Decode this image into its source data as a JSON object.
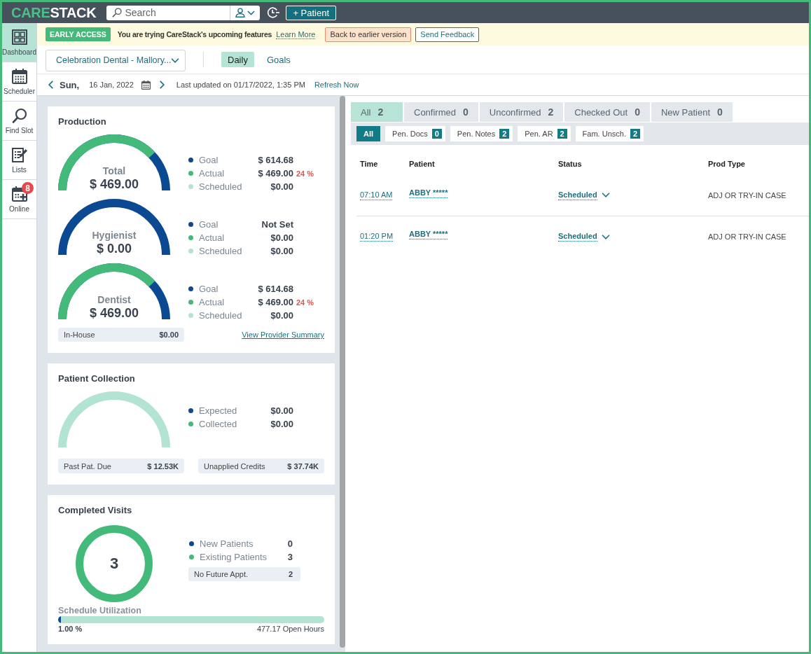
{
  "top_bar": {
    "logo": {
      "accent": "CARE",
      "main": "STACK"
    },
    "search": {
      "placeholder": "Search"
    },
    "add_button": "+ Patient"
  },
  "sidebar": {
    "items": [
      {
        "label": "Dashboard",
        "selected": true
      },
      {
        "label": "Scheduler",
        "selected": false
      },
      {
        "label": "Find Slot",
        "selected": false
      },
      {
        "label": "Lists",
        "selected": false
      },
      {
        "label": "Online",
        "selected": false,
        "badge": "8"
      }
    ]
  },
  "banner": {
    "tag": "EARLY ACCESS",
    "message": "You are trying CareStack's upcoming features",
    "link": "Learn More",
    "buttons": [
      {
        "label": "Back to earlier version",
        "kind": "warning"
      },
      {
        "label": "Send Feedback",
        "kind": "outline"
      }
    ]
  },
  "toolbar": {
    "location": "Celebration Dental - Mallory...",
    "tabs": [
      {
        "label": "Daily",
        "selected": true
      },
      {
        "label": "Goals",
        "selected": false
      }
    ]
  },
  "date_bar": {
    "day": "Sun,",
    "date": "16 Jan, 2022",
    "last_updated": "Last updated on 01/17/2022, 1:35 PM",
    "refresh_link": "Refresh Now"
  },
  "production": {
    "title": "Production",
    "gauges": [
      {
        "label": "Total",
        "amount": "$ 469.00",
        "level": 0.76,
        "legend": [
          {
            "label": "Goal",
            "value": "$ 614.68",
            "color": "#0b4a93"
          },
          {
            "label": "Actual",
            "value": "$ 469.00",
            "percent": "24 %",
            "color": "#43b97a"
          },
          {
            "label": "Scheduled",
            "value": "$0.00",
            "color": "#b3e3d3"
          }
        ]
      },
      {
        "label": "Hygienist",
        "amount": "$ 0.00",
        "legend": [
          {
            "label": "Goal",
            "value": "Not Set",
            "color": "#0b4a93"
          },
          {
            "label": "Actual",
            "value": "$0.00",
            "color": "#43b97a"
          },
          {
            "label": "Scheduled",
            "value": "$0.00",
            "color": "#b3e3d3"
          }
        ]
      },
      {
        "label": "Dentist",
        "amount": "$ 469.00",
        "level": 0.76,
        "legend": [
          {
            "label": "Goal",
            "value": "$ 614.68",
            "color": "#0b4a93"
          },
          {
            "label": "Actual",
            "value": "$ 469.00",
            "percent": "24 %",
            "color": "#43b97a"
          },
          {
            "label": "Scheduled",
            "value": "$0.00",
            "color": "#b3e3d3"
          }
        ]
      }
    ],
    "in_house": {
      "label": "In-House",
      "value": "$0.00"
    },
    "summary_link": "View Provider Summary"
  },
  "patient_collection": {
    "title": "Patient Collection",
    "gauge": {
      "empty": true
    },
    "legend": [
      {
        "label": "Expected",
        "value": "$0.00",
        "color": "#0b4a93"
      },
      {
        "label": "Collected",
        "value": "$0.00",
        "color": "#43b97a"
      }
    ],
    "totals": [
      {
        "label": "Past Pat. Due",
        "value": "$ 12.53K"
      },
      {
        "label": "Unapplied Credits",
        "value": "$ 37.74K"
      }
    ]
  },
  "completed_visits": {
    "title": "Completed Visits",
    "total": "3",
    "legend": [
      {
        "label": "New Patients",
        "value": "0",
        "color": "#0b4a93"
      },
      {
        "label": "Existing Patients",
        "value": "3",
        "color": "#43b97a"
      }
    ],
    "no_future_appt": {
      "label": "No Future Appt.",
      "value": "2"
    },
    "utilization": {
      "label": "Schedule Utilization",
      "level": 0.01,
      "percent": "1.00 %",
      "open_hours": "477.17 Open Hours"
    }
  },
  "appointments": {
    "status_tabs": [
      {
        "label": "All",
        "count": "2",
        "selected": true
      },
      {
        "label": "Confirmed",
        "count": "0",
        "selected": false
      },
      {
        "label": "Unconfirmed",
        "count": "2",
        "selected": false
      },
      {
        "label": "Checked Out",
        "count": "0",
        "selected": false
      },
      {
        "label": "New Patient",
        "count": "0",
        "selected": false
      }
    ],
    "filters": [
      {
        "label": "All",
        "selected": true
      },
      {
        "label": "Pen. Docs",
        "count": "0",
        "selected": false
      },
      {
        "label": "Pen. Notes",
        "count": "2",
        "selected": false
      },
      {
        "label": "Pen. AR",
        "count": "2",
        "selected": false
      },
      {
        "label": "Fam. Unsch.",
        "count": "2",
        "selected": false
      }
    ],
    "table": {
      "columns": [
        "Time",
        "Patient",
        "Status",
        "Prod Type"
      ],
      "rows": [
        {
          "time": "07:10 AM",
          "patient": "ABBY *****",
          "status": "Scheduled",
          "prod_type": "ADJ OR TRY-IN CASE"
        },
        {
          "time": "01:20 PM",
          "patient": "ABBY *****",
          "status": "Scheduled",
          "prod_type": "ADJ OR TRY-IN CASE"
        }
      ]
    }
  }
}
